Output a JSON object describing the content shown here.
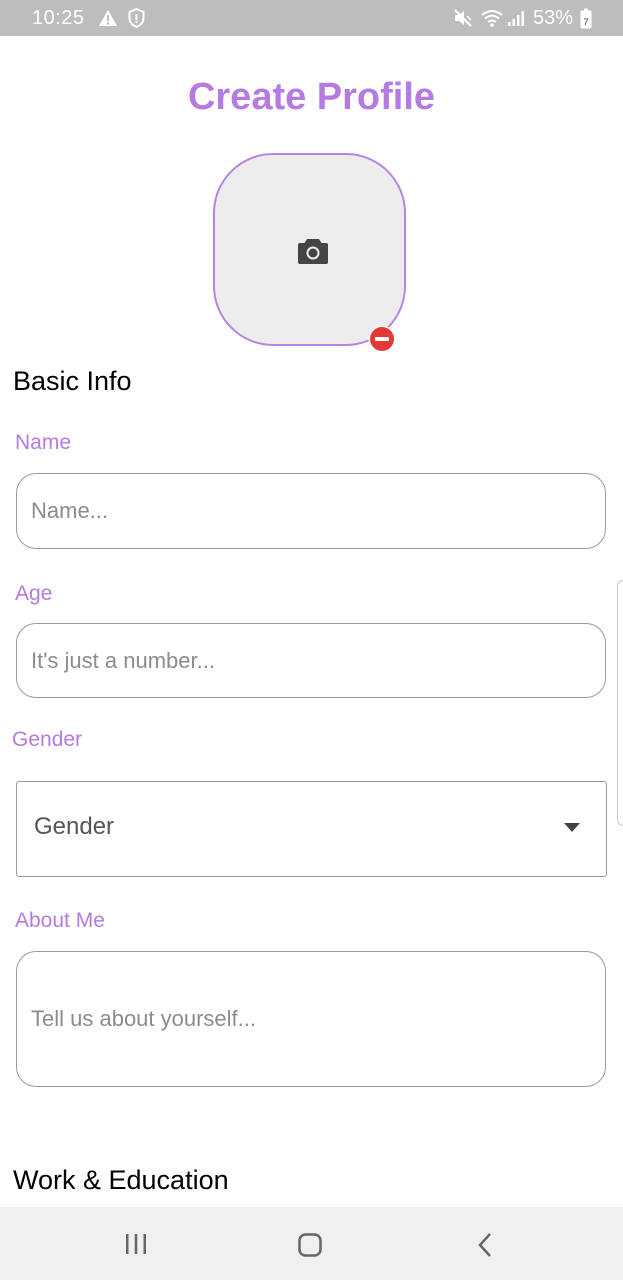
{
  "status_bar": {
    "time": "10:25",
    "battery_percent": "53%",
    "battery_detail": "7",
    "icons": [
      "warning-icon",
      "shield-icon",
      "mute-icon",
      "wifi-icon",
      "signal-icon",
      "battery-icon"
    ]
  },
  "header": {
    "title": "Create Profile"
  },
  "avatar": {
    "icon": "camera-icon",
    "remove_icon": "remove-circle-icon"
  },
  "basic_info": {
    "heading": "Basic Info",
    "name": {
      "label": "Name",
      "placeholder": "Name...",
      "value": ""
    },
    "age": {
      "label": "Age",
      "placeholder": "It's just a number...",
      "value": ""
    },
    "gender": {
      "label": "Gender",
      "selected": "Gender",
      "icon": "dropdown-arrow-icon"
    },
    "about": {
      "label": "About Me",
      "placeholder": "Tell us about yourself...",
      "value": ""
    }
  },
  "work_education": {
    "heading": "Work & Education"
  },
  "nav_bar": {
    "icons": [
      "recents-icon",
      "home-icon",
      "back-icon"
    ]
  },
  "colors": {
    "accent": "#b57be0",
    "avatar_border": "#b784e6",
    "remove_badge": "#e53935",
    "status_bar": "#bdbdbd",
    "nav_bar": "#f0f0f0",
    "field_border": "#9a9a9a",
    "placeholder": "#8c8c8c"
  }
}
